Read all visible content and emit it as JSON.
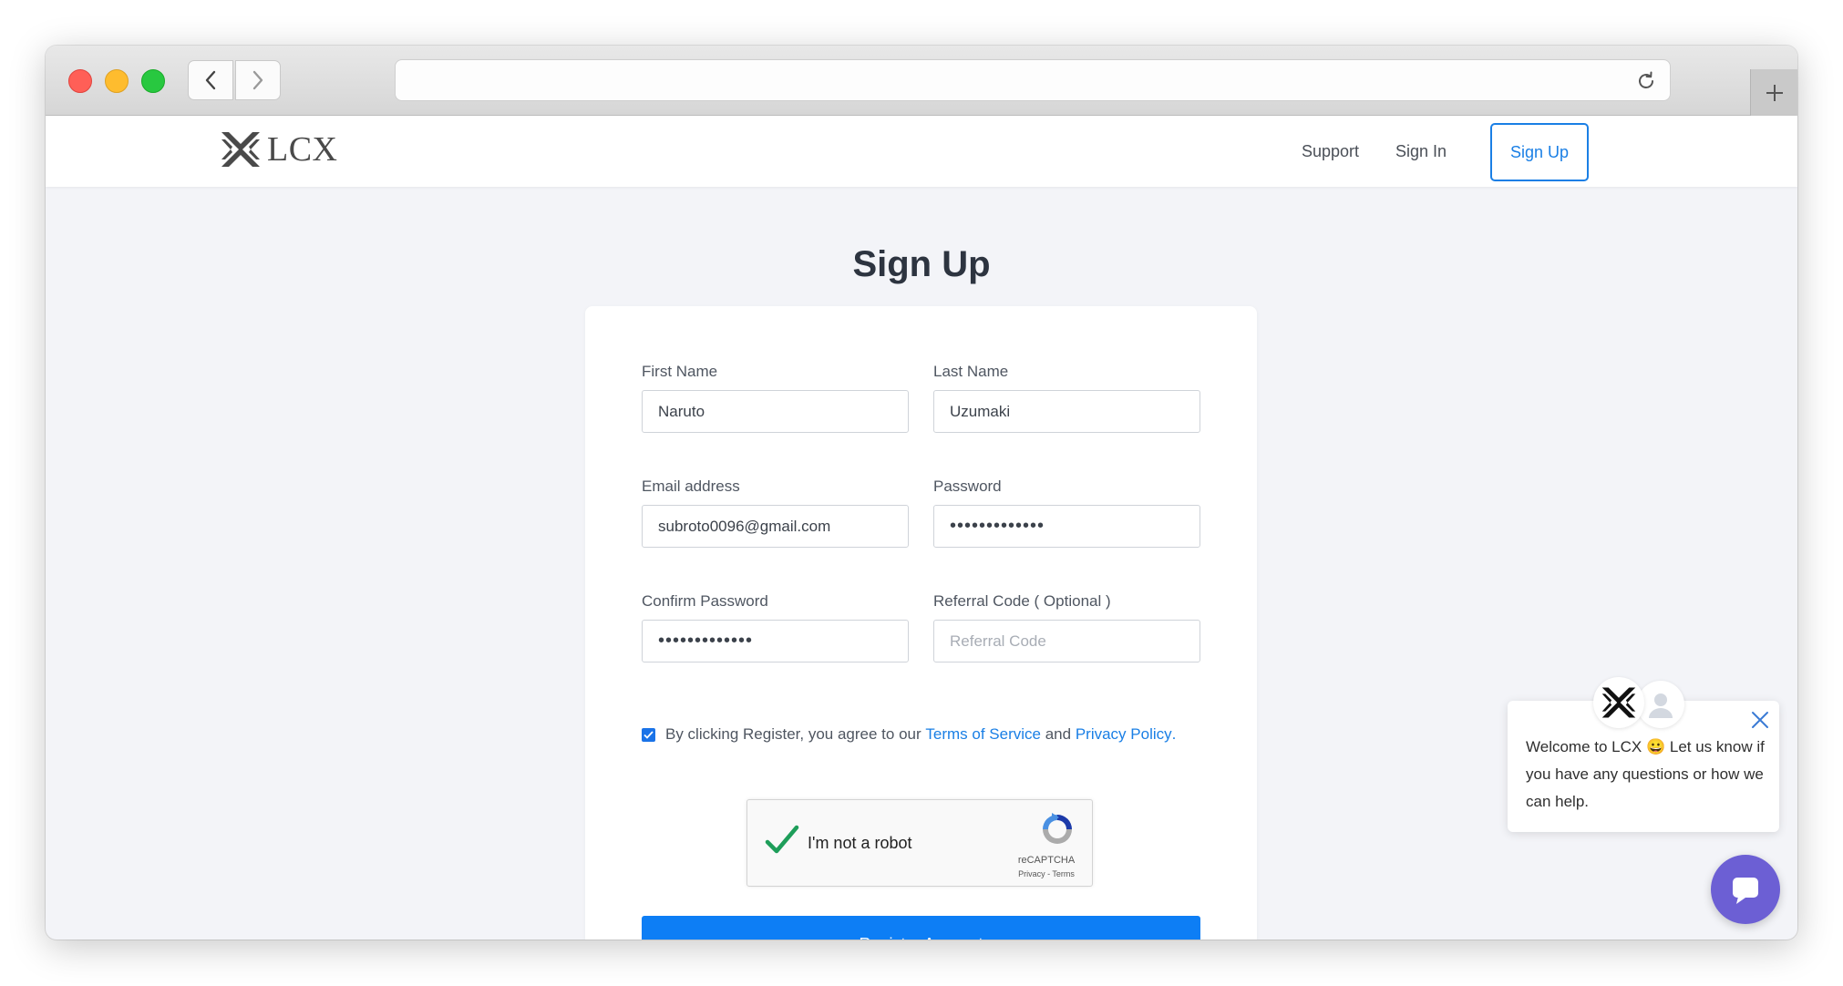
{
  "browser": {
    "back_icon": "chevron-left-icon",
    "forward_icon": "chevron-right-icon",
    "reload_icon": "reload-icon",
    "new_tab_icon": "plus-icon",
    "url": ""
  },
  "site": {
    "logo_text": "LCX",
    "nav": {
      "support": "Support",
      "sign_in": "Sign In",
      "sign_up": "Sign Up"
    }
  },
  "form": {
    "title": "Sign Up",
    "first_name": {
      "label": "First Name",
      "value": "Naruto"
    },
    "last_name": {
      "label": "Last Name",
      "value": "Uzumaki"
    },
    "email": {
      "label": "Email address",
      "value": "subroto0096@gmail.com"
    },
    "password": {
      "label": "Password",
      "value": "•••••••••••••"
    },
    "confirm_password": {
      "label": "Confirm Password",
      "value": "•••••••••••••"
    },
    "referral": {
      "label": "Referral Code ( Optional )",
      "placeholder": "Referral Code"
    },
    "agree": {
      "checked": true,
      "prefix": "By clicking Register, you agree to our",
      "terms": "Terms of Service",
      "and": "and",
      "privacy": "Privacy Policy",
      "suffix": "."
    },
    "recaptcha": {
      "label": "I'm not a robot",
      "brand": "reCAPTCHA",
      "links": "Privacy - Terms"
    },
    "register_button": "Register Account"
  },
  "chat": {
    "message_part1": "Welcome to LCX",
    "emoji": "😀",
    "message_part2": "Let us know if you have any questions or how we can help.",
    "close_icon": "close-icon",
    "launcher_icon": "chat-bubble-icon"
  },
  "colors": {
    "accent": "#1a7fe5",
    "button": "#0d7ef5",
    "chat_launcher": "#6c5fd4",
    "recaptcha_check": "#1e9e5a"
  }
}
